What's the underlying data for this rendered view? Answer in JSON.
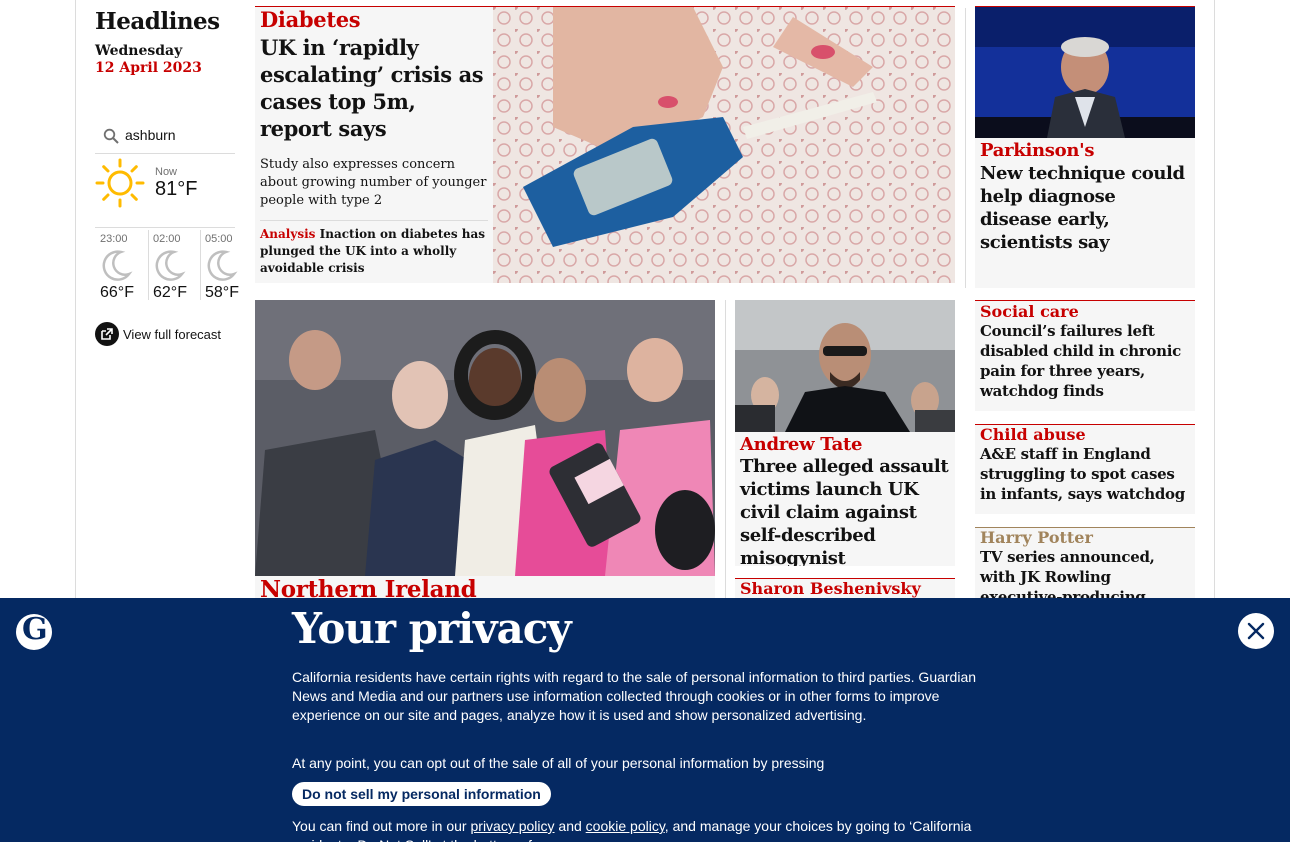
{
  "rail": {
    "heading": "Headlines",
    "weekday": "Wednesday",
    "date": "12 April 2023",
    "location": "ashburn",
    "now_label": "Now",
    "now_temp": "81°F",
    "forecast": [
      {
        "time": "23:00",
        "temp": "66°F"
      },
      {
        "time": "02:00",
        "temp": "62°F"
      },
      {
        "time": "05:00",
        "temp": "58°F"
      }
    ],
    "view_forecast": "View full forecast"
  },
  "stories": {
    "diabetes": {
      "kicker": "Diabetes",
      "headline": "UK in ‘rapidly escalating’ crisis as cases top 5m, report says",
      "standfirst": "Study also expresses concern about growing number of younger people with type 2",
      "related_kicker": "Analysis",
      "related_text": "Inaction on diabetes has plunged the UK into a wholly avoidable crisis"
    },
    "parkinsons": {
      "kicker": "Parkinson's",
      "headline": "New technique could help diagnose disease early, scientists say"
    },
    "northern_ireland": {
      "kicker": "Northern Ireland"
    },
    "andrew_tate": {
      "kicker": "Andrew Tate",
      "headline": "Three alleged assault victims launch UK civil claim against self-described misogynist"
    },
    "sharon": {
      "kicker": "Sharon Beshenivsky"
    },
    "social_care": {
      "kicker": "Social care",
      "headline": "Council’s failures left disabled child in chronic pain for three years, watchdog finds"
    },
    "child_abuse": {
      "kicker": "Child abuse",
      "headline": "A&E staff in England struggling to spot cases in infants, says watchdog"
    },
    "harry_potter": {
      "kicker": "Harry Potter",
      "headline": "TV series announced, with JK Rowling executive-producing"
    }
  },
  "banner": {
    "title": "Your privacy",
    "para1": "California residents have certain rights with regard to the sale of personal information to third parties. Guardian News and Media and our partners use information collected through cookies or in other forms to improve experience on our site and pages, analyze how it is used and show personalized advertising.",
    "para2": "At any point, you can opt out of the sale of all of your personal information by pressing",
    "button": "Do not sell my personal information",
    "para3_start": "You can find out more in our ",
    "privacy_link": "privacy policy",
    "and": " and ",
    "cookie_link": "cookie policy",
    "para3_end": ", and manage your choices by going to ‘California resident – Do Not Sell’ at the bottom of any page."
  },
  "colors": {
    "news_red": "#c70000",
    "harry_potter_kicker": "#a1845c",
    "banner_bg": "#052962"
  }
}
